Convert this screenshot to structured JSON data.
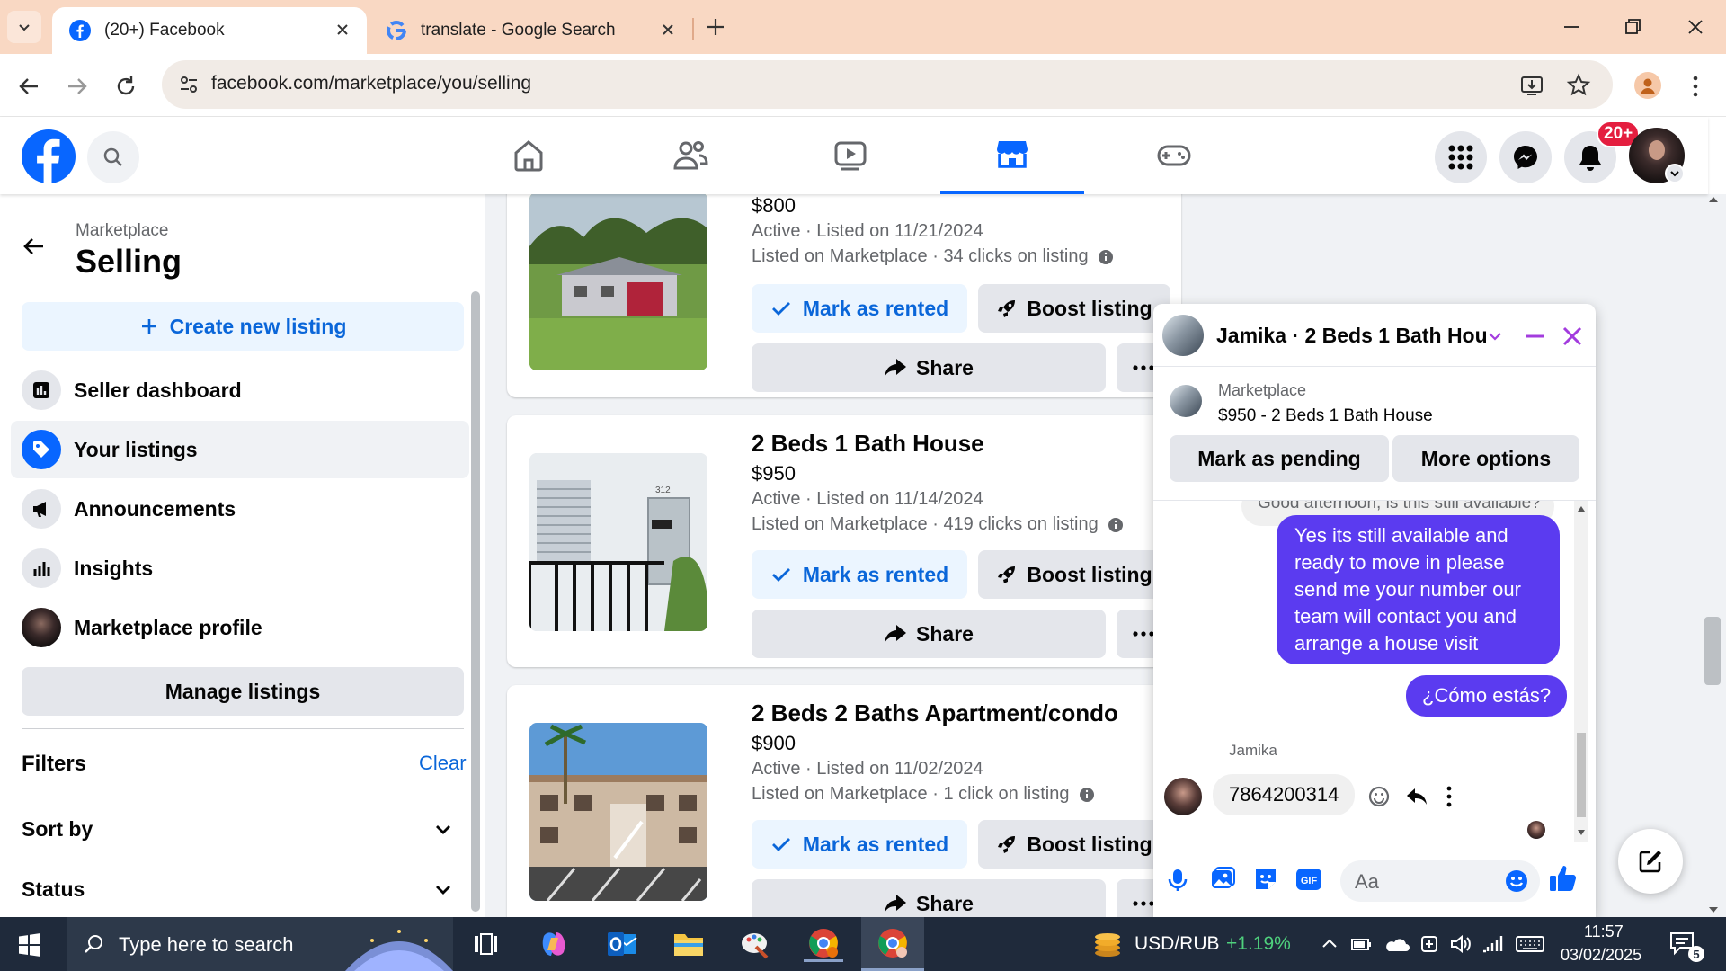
{
  "browser": {
    "tabs": [
      {
        "title": "(20+) Facebook",
        "active": true
      },
      {
        "title": "translate - Google Search",
        "active": false
      }
    ],
    "url": "facebook.com/marketplace/you/selling"
  },
  "header": {
    "notification_badge": "20+"
  },
  "sidebar": {
    "section": "Marketplace",
    "title": "Selling",
    "create_button": "Create new listing",
    "items": [
      {
        "label": "Seller dashboard",
        "icon": "dashboard-icon"
      },
      {
        "label": "Your listings",
        "icon": "tag-icon",
        "active": true
      },
      {
        "label": "Announcements",
        "icon": "megaphone-icon"
      },
      {
        "label": "Insights",
        "icon": "bar-chart-icon"
      },
      {
        "label": "Marketplace profile",
        "icon": "avatar"
      }
    ],
    "manage_button": "Manage listings",
    "filters_label": "Filters",
    "clear_label": "Clear",
    "filter_sections": [
      {
        "label": "Sort by"
      },
      {
        "label": "Status"
      }
    ]
  },
  "listings": [
    {
      "title": "",
      "price": "$800",
      "status": "Active · Listed on 11/21/2024",
      "stats": "Listed on Marketplace · 34 clicks on listing",
      "mark_label": "Mark as rented",
      "boost_label": "Boost listing",
      "share_label": "Share"
    },
    {
      "title": "2 Beds 1 Bath House",
      "price": "$950",
      "status": "Active · Listed on 11/14/2024",
      "stats": "Listed on Marketplace · 419 clicks on listing",
      "mark_label": "Mark as rented",
      "boost_label": "Boost listing",
      "share_label": "Share"
    },
    {
      "title": "2 Beds 2 Baths Apartment/condo",
      "price": "$900",
      "status": "Active · Listed on 11/02/2024",
      "stats": "Listed on Marketplace · 1 click on listing",
      "mark_label": "Mark as rented",
      "boost_label": "Boost listing",
      "share_label": "Share"
    }
  ],
  "chat": {
    "title": "Jamika · 2 Beds 1 Bath Hou...",
    "context_label": "Marketplace",
    "context_item": "$950 - 2 Beds 1 Bath House",
    "pending_button": "Mark as pending",
    "options_button": "More options",
    "partial_message": "Good afternoon, is this still available?",
    "messages": [
      {
        "from": "me",
        "text": "Yes its still available and ready to move in please send me your number our team will contact you and arrange a house visit"
      },
      {
        "from": "me",
        "text": "¿Cómo estás?"
      },
      {
        "from": "Jamika",
        "text": "7864200314"
      }
    ],
    "sender_name": "Jamika",
    "input_placeholder": "Aa"
  },
  "taskbar": {
    "search_placeholder": "Type here to search",
    "ticker_label": "USD/RUB",
    "ticker_change": "+1.19%",
    "time": "11:57",
    "date": "03/02/2025",
    "notification_count": "5"
  },
  "colors": {
    "fb_blue": "#0866ff",
    "chat_bubble": "#5b3bf0",
    "tab_strip": "#f9d8c3",
    "badge_red": "#e41e3f",
    "ticker_green": "#4fd17d"
  }
}
